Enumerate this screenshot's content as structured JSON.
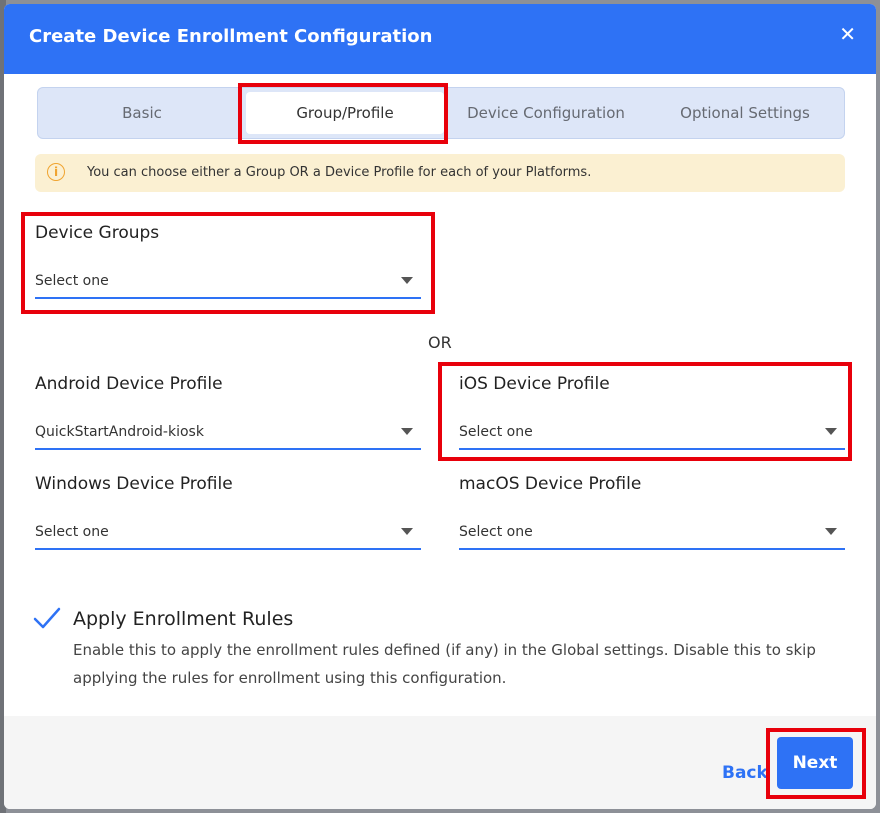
{
  "dialog": {
    "title": "Create Device Enrollment Configuration",
    "close_glyph": "✕"
  },
  "steps": [
    {
      "label": "Basic",
      "active": false
    },
    {
      "label": "Group/Profile",
      "active": true
    },
    {
      "label": "Device Configuration",
      "active": false
    },
    {
      "label": "Optional Settings",
      "active": false
    }
  ],
  "info": {
    "icon": "info-icon",
    "icon_glyph": "i",
    "text": "You can choose either a Group OR a Device Profile for each of your Platforms."
  },
  "device_groups": {
    "label": "Device Groups",
    "value": "Select one"
  },
  "or_text": "OR",
  "android": {
    "label": "Android Device Profile",
    "value": "QuickStartAndroid-kiosk"
  },
  "ios": {
    "label": "iOS Device Profile",
    "value": "Select one"
  },
  "windows": {
    "label": "Windows Device Profile",
    "value": "Select one"
  },
  "macos": {
    "label": "macOS Device Profile",
    "value": "Select one"
  },
  "enrollment_rules": {
    "checked": true,
    "label": "Apply Enrollment Rules",
    "description": "Enable this to apply the enrollment rules defined (if any) in the Global settings. Disable this to skip applying the rules for enrollment using this configuration."
  },
  "footer": {
    "back_label": "Back",
    "next_label": "Next"
  },
  "colors": {
    "accent": "#2e72f5",
    "highlight": "#e8000b",
    "info_bg": "#fbf0d2"
  }
}
